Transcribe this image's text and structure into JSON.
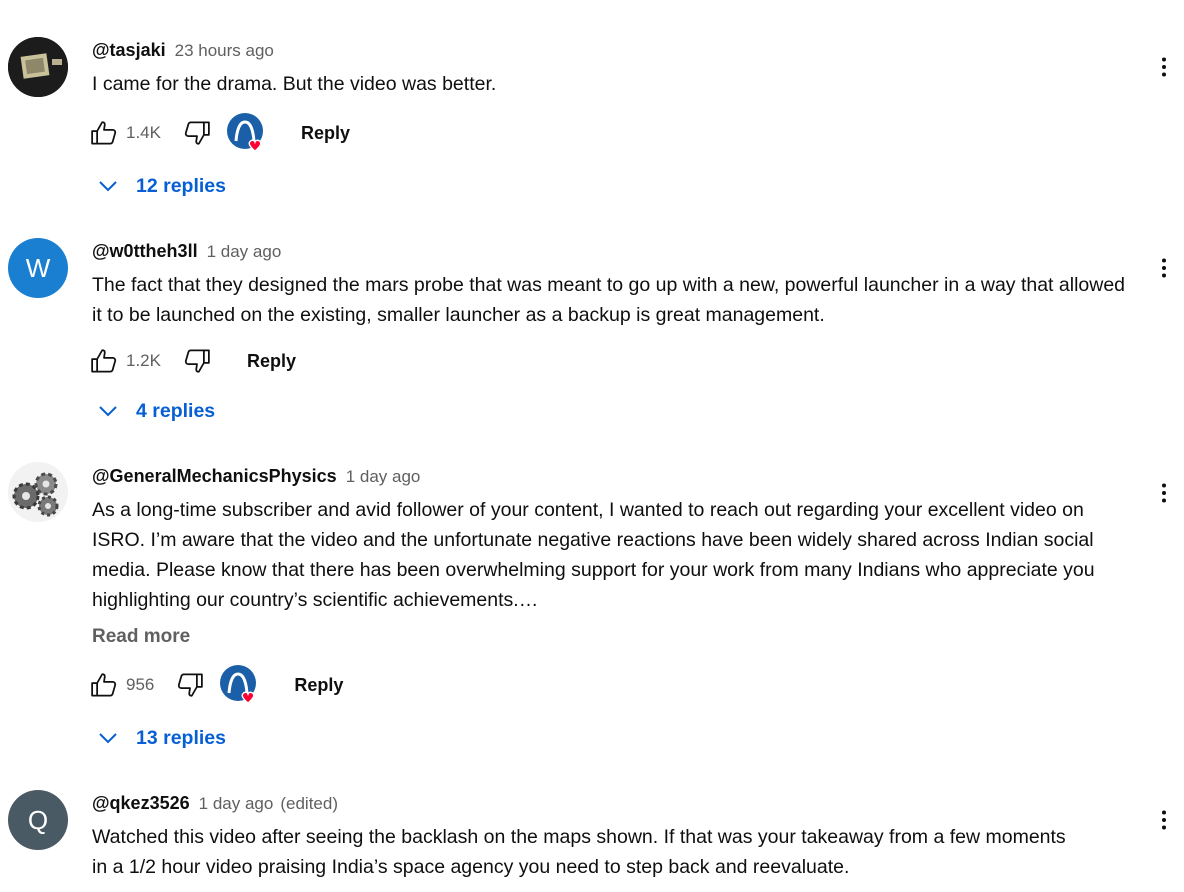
{
  "comments": [
    {
      "author": "@tasjaki",
      "time": "23 hours ago",
      "edited": "",
      "avatar_letter": "",
      "text": "I came for the drama. But the video was better.",
      "likes": "1.4K",
      "reply_label": "Reply",
      "replies_label": "12 replies",
      "has_creator_heart": true
    },
    {
      "author": "@w0ttheh3ll",
      "time": "1 day ago",
      "edited": "",
      "avatar_letter": "W",
      "text": "The fact that they designed the mars probe that was meant to go up with a new, powerful launcher in a way that allowed it to be launched on the existing, smaller launcher as a backup is great management.",
      "likes": "1.2K",
      "reply_label": "Reply",
      "replies_label": "4 replies",
      "has_creator_heart": false
    },
    {
      "author": "@GeneralMechanicsPhysics",
      "time": "1 day ago",
      "edited": "",
      "avatar_letter": "",
      "text": "As a long-time subscriber and avid follower of your content, I wanted to reach out regarding your excellent video on ISRO. I’m aware that the video and the unfortunate negative reactions have been widely shared across Indian social media. Please know that there has been overwhelming support for your work from many Indians who appreciate you highlighting our country’s scientific achievements.…",
      "read_more": "Read more",
      "likes": "956",
      "reply_label": "Reply",
      "replies_label": "13 replies",
      "has_creator_heart": true
    },
    {
      "author": "@qkez3526",
      "time": "1 day ago",
      "edited": "(edited)",
      "avatar_letter": "Q",
      "text": "Watched this video after seeing the backlash on the maps shown. If that was your takeaway from a few moments in a 1/2 hour video praising India’s space agency you need to step back and reevaluate.",
      "likes": "",
      "reply_label": "",
      "replies_label": "",
      "has_creator_heart": false
    }
  ],
  "icons": {
    "like": "thumbs-up-icon",
    "dislike": "thumbs-down-icon",
    "more": "more-vertical-icon",
    "expand": "chevron-down-icon",
    "creator_heart": "creator-heart-icon"
  },
  "colors": {
    "link_blue": "#065fd4",
    "heart_red": "#ff0033",
    "avatar_w": "#1a7fd1",
    "avatar_q": "#4a5a64"
  }
}
